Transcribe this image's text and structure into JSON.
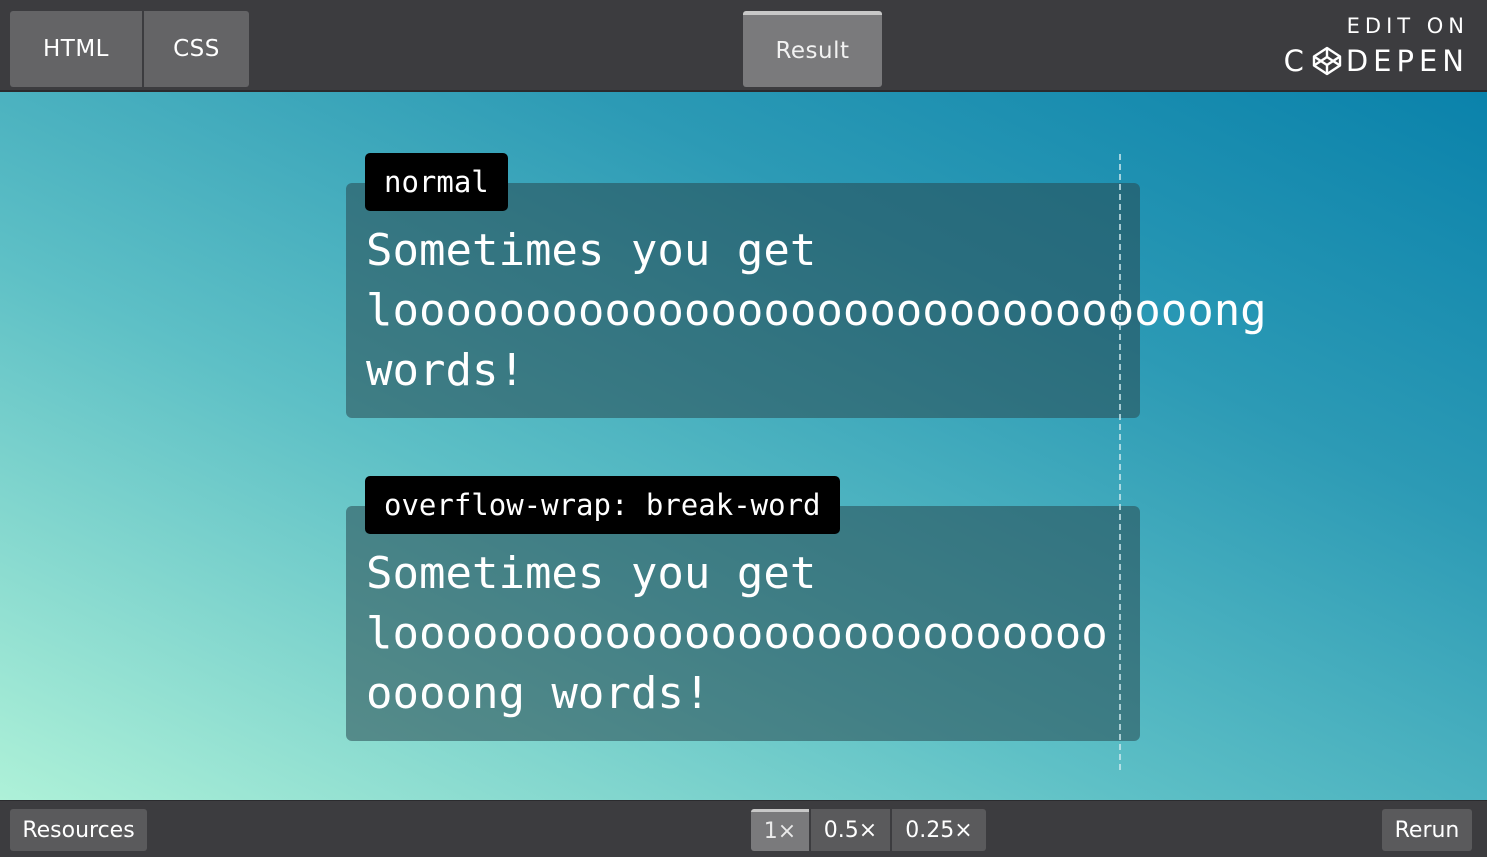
{
  "toolbar": {
    "tabs": [
      {
        "label": "HTML"
      },
      {
        "label": "CSS"
      },
      {
        "label": "Result",
        "active": true
      }
    ],
    "edit_on": "EDIT ON",
    "brand_before": "C",
    "brand_after": "DEPEN",
    "brand_icon": "codepen-cube-icon"
  },
  "demos": [
    {
      "label": "normal",
      "text": "Sometimes you get looooooooooooooooooooooooooooooong words!"
    },
    {
      "label": "overflow-wrap: break-word",
      "text": "Sometimes you get looooooooooooooooooooooooooooooong words!"
    }
  ],
  "footer": {
    "resources_label": "Resources",
    "zoom_options": [
      {
        "label": "1×",
        "active": true
      },
      {
        "label": "0.5×"
      },
      {
        "label": "0.25×"
      }
    ],
    "rerun_label": "Rerun"
  },
  "colors": {
    "bar": "#3c3c3f",
    "gradient_start": "#aef1d8",
    "gradient_end": "#0a82ab",
    "label_bg": "#000000"
  }
}
